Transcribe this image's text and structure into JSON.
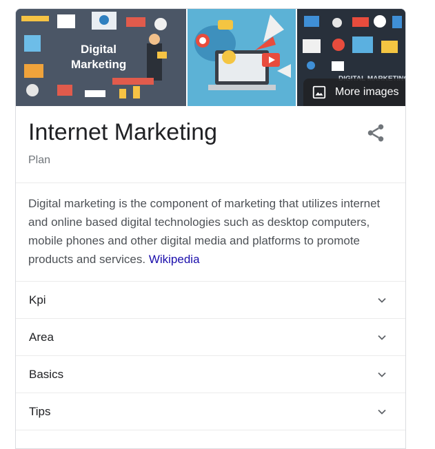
{
  "images": {
    "image1_text": [
      "Digital",
      "Marketing"
    ],
    "image3_text": "DIGITAL MARKETING",
    "more_images_label": "More images"
  },
  "entity": {
    "title": "Internet Marketing",
    "subtitle": "Plan"
  },
  "description": {
    "text": "Digital marketing is the component of marketing that utilizes internet and online based digital technologies such as desktop computers, mobile phones and other digital media and platforms to promote products and services.",
    "source_link": "Wikipedia"
  },
  "sections": [
    {
      "label": "Kpi"
    },
    {
      "label": "Area"
    },
    {
      "label": "Basics"
    },
    {
      "label": "Tips"
    }
  ],
  "colors": {
    "link": "#1a0dab",
    "border": "#dadce0"
  },
  "icons": {
    "share": "share-icon",
    "image": "image-icon",
    "chevron": "chevron-down-icon"
  }
}
